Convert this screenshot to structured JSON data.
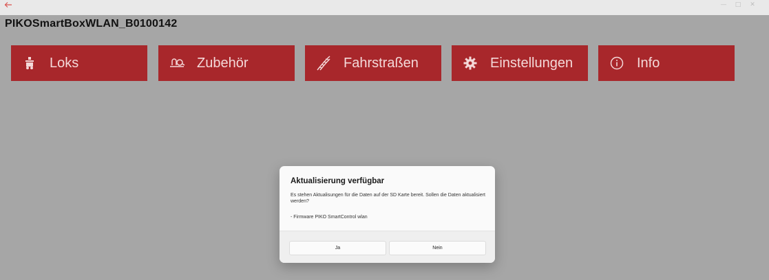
{
  "titlebar": {
    "back_icon": "arrow-left-icon",
    "minimize_glyph": "—",
    "maximize_glyph": "□",
    "close_glyph": "✕"
  },
  "app": {
    "title": "PIKOSmartBoxWLAN_B0100142"
  },
  "nav": [
    {
      "label": "Loks",
      "icon": "locomotive-icon"
    },
    {
      "label": "Zubehör",
      "icon": "accessory-icon"
    },
    {
      "label": "Fahrstraßen",
      "icon": "route-icon"
    },
    {
      "label": "Einstellungen",
      "icon": "gear-icon"
    },
    {
      "label": "Info",
      "icon": "info-icon"
    }
  ],
  "dialog": {
    "title": "Aktualisierung verfügbar",
    "message": "Es stehen Aktualisungen für die Daten auf der SD Karte bereit. Sollen die Daten aktualisiert werden?",
    "items": [
      "- Firmware PIKO SmartControl wlan"
    ],
    "yes_label": "Ja",
    "no_label": "Nein"
  },
  "colors": {
    "tile": "#a8272b",
    "overlay_bg": "#a6a6a6",
    "dialog_bg": "#fafafa"
  }
}
